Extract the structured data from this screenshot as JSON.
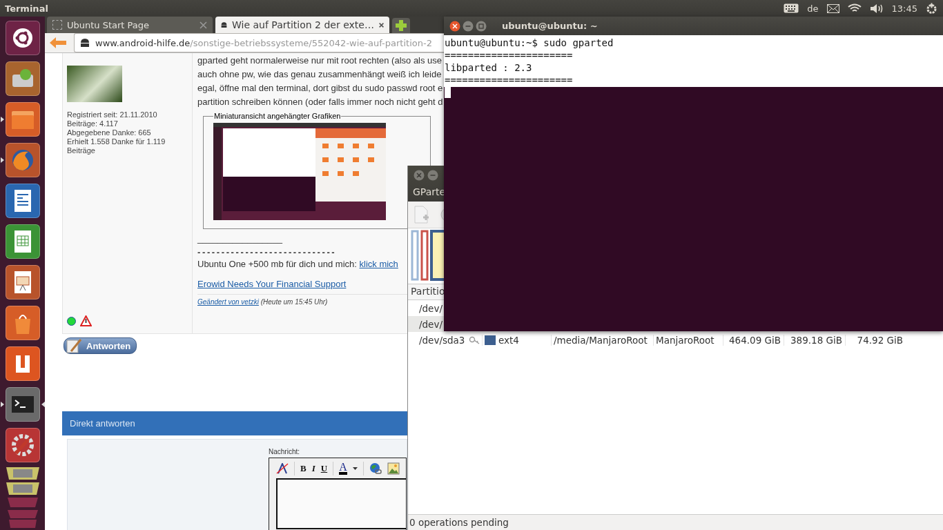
{
  "top_panel": {
    "app_title": "Terminal",
    "keyboard_layout": "de",
    "clock": "13:45"
  },
  "launcher": {
    "items": [
      {
        "kind": "dash",
        "running": false,
        "focused": false
      },
      {
        "kind": "installer",
        "running": false,
        "focused": false
      },
      {
        "kind": "files",
        "running": true,
        "focused": false
      },
      {
        "kind": "browser",
        "running": true,
        "focused": false
      },
      {
        "kind": "writer",
        "running": false,
        "focused": false
      },
      {
        "kind": "calc",
        "running": false,
        "focused": false
      },
      {
        "kind": "impress",
        "running": false,
        "focused": false
      },
      {
        "kind": "software",
        "running": false,
        "focused": false
      },
      {
        "kind": "update",
        "running": false,
        "focused": false
      },
      {
        "kind": "terminal",
        "running": true,
        "focused": true
      },
      {
        "kind": "settings",
        "running": false,
        "focused": false
      }
    ]
  },
  "browser": {
    "tabs": [
      {
        "title": "Ubuntu Start Page",
        "selected": false
      },
      {
        "title": "Wie auf Partition 2 der exte…",
        "selected": true
      }
    ],
    "url_host": "www.android-hilfe.de",
    "url_path": "/sonstige-betriebssysteme/552042-wie-auf-partition-2"
  },
  "post": {
    "user_stats": [
      "Registriert seit: 21.11.2010",
      "Beiträge: 4.117",
      "Abgegebene Danke: 665",
      "Erhielt 1.558 Danke für 1.119 Beiträge"
    ],
    "online": true,
    "body_lines": [
      "gparted geht normalerweise nur mit root rechten (also als use",
      "auch ohne pw, wie das genau zusammenhängt weiß ich leide",
      "egal, öffne mal den terminal, dort gibst du sudo passwd root e",
      "partition schreiben können (oder falls immer noch nicht geht d"
    ],
    "attachments_legend": "Miniaturansicht angehängter Grafiken",
    "signature_rule": "_________________",
    "signature_dashes": "- - - - - - - - - - - - - - - - - - - - - - - - - - - - -",
    "signature_text": "Ubuntu One +500 mb für dich und mich:",
    "signature_link": "klick mich",
    "erowid_link": "Erowid Needs Your Financial Support",
    "edited_by_link": "Geändert von vetzki",
    "edited_time": "(Heute um 15:45 Uhr)"
  },
  "reply_button": "Antworten",
  "quick_reply": {
    "title": "Direkt antworten",
    "message_label": "Nachricht:",
    "format_buttons": [
      "B",
      "I",
      "U"
    ],
    "font_color_button": "A"
  },
  "gparted": {
    "title": "GParte",
    "column_header": "Partitio",
    "rows": [
      {
        "partition": "/dev/",
        "selected": false
      },
      {
        "partition": "/dev/",
        "selected": true
      },
      {
        "partition": "/dev/sda3",
        "locked": true,
        "color": "#3d5f8f",
        "filesystem": "ext4",
        "mount_point": "/media/ManjaroRoot",
        "label": "ManjaroRoot",
        "size": "464.09 GiB",
        "used": "389.18 GiB",
        "unused": "74.92 GiB",
        "selected": false
      }
    ],
    "status": "0 operations pending"
  },
  "terminal": {
    "title": "ubuntu@ubuntu: ~",
    "lines": [
      "ubuntu@ubuntu:~$ sudo gparted",
      "======================",
      "libparted : 2.3",
      "======================"
    ]
  }
}
